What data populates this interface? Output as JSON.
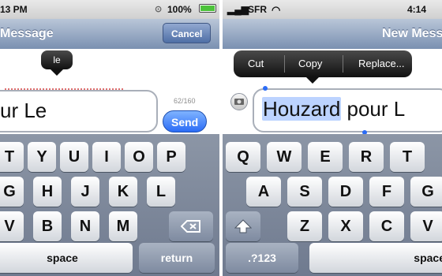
{
  "left": {
    "status": {
      "time": "13 PM",
      "battery": "100%"
    },
    "nav": {
      "title": "Message",
      "cancel": "Cancel"
    },
    "suggestion": "le",
    "input_text": "ur Le",
    "char_count": "62/160",
    "send": "Send",
    "keyboard": {
      "row1": [
        "T",
        "Y",
        "U",
        "I",
        "O",
        "P"
      ],
      "row2": [
        "G",
        "H",
        "J",
        "K",
        "L"
      ],
      "row3": [
        "V",
        "B",
        "N",
        "M"
      ],
      "space": "space",
      "return": "return",
      "backspace_icon": "backspace-icon"
    }
  },
  "right": {
    "status": {
      "carrier": "SFR",
      "time": "4:14"
    },
    "nav": {
      "title": "New Mess"
    },
    "menu": {
      "cut": "Cut",
      "copy": "Copy",
      "replace": "Replace..."
    },
    "input": {
      "selected": "Houzard",
      "rest": " pour L"
    },
    "keyboard": {
      "row1": [
        "Q",
        "W",
        "E",
        "R",
        "T"
      ],
      "row2": [
        "A",
        "S",
        "D",
        "F",
        "G"
      ],
      "row3": [
        "Z",
        "X",
        "C",
        "V"
      ],
      "numkey": ".?123",
      "space": "space",
      "shift_icon": "shift-icon"
    }
  },
  "colors": {
    "accent": "#2b6cf6",
    "nav_top": "#b9c6d8",
    "nav_bottom": "#7a90b1"
  }
}
